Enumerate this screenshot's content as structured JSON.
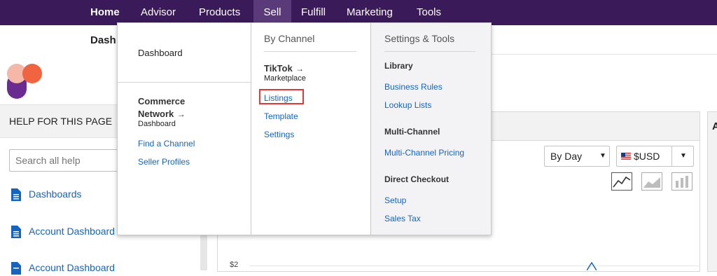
{
  "topnav": {
    "items": [
      {
        "label": "Home"
      },
      {
        "label": "Advisor"
      },
      {
        "label": "Products"
      },
      {
        "label": "Sell"
      },
      {
        "label": "Fulfill"
      },
      {
        "label": "Marketing"
      },
      {
        "label": "Tools"
      }
    ]
  },
  "subheader": {
    "breadcrumb": "Dash"
  },
  "sidebar": {
    "help_title": "HELP FOR THIS PAGE",
    "search_placeholder": "Search all help",
    "links": [
      {
        "label": "Dashboards"
      },
      {
        "label": "Account Dashboard"
      },
      {
        "label": "Account Dashboard"
      }
    ]
  },
  "main": {
    "period_select": "By Day",
    "currency_select": "$USD",
    "chart_axis_label": "$2",
    "right_panel_letter": "A"
  },
  "megamenu": {
    "col1": {
      "dashboard": "Dashboard",
      "commerce_network_title": "Commerce Network",
      "commerce_network_arrow": "→",
      "commerce_network_sub": "Dashboard",
      "links": [
        {
          "label": "Find a Channel"
        },
        {
          "label": "Seller Profiles"
        }
      ]
    },
    "col2": {
      "heading": "By Channel",
      "tiktok_title": "TikTok",
      "tiktok_arrow": "→",
      "tiktok_sub": "Marketplace",
      "links": [
        {
          "label": "Listings"
        },
        {
          "label": "Template"
        },
        {
          "label": "Settings"
        }
      ]
    },
    "col3": {
      "heading": "Settings & Tools",
      "library_heading": "Library",
      "library_links": [
        {
          "label": "Business Rules"
        },
        {
          "label": "Lookup Lists"
        }
      ],
      "multichannel_heading": "Multi-Channel",
      "multichannel_links": [
        {
          "label": "Multi-Channel Pricing"
        }
      ],
      "checkout_heading": "Direct Checkout",
      "checkout_links": [
        {
          "label": "Setup"
        },
        {
          "label": "Sales Tax"
        }
      ]
    }
  },
  "colors": {
    "topnav_bg": "#3b1a5a",
    "link": "#1565c0",
    "highlight": "#e53935"
  }
}
